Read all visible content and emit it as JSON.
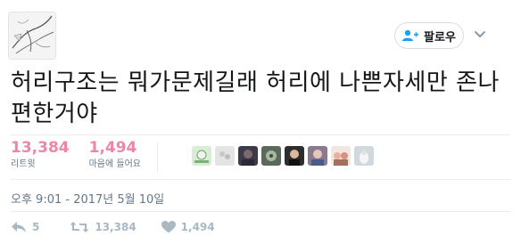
{
  "profile": {
    "avatar_alt": "manga sketch avatar"
  },
  "follow": {
    "label": "팔로우",
    "icon": "add-user-icon"
  },
  "tweet": {
    "text": "허리구조는 뭐가문제길래 허리에 나쁜자세만 존나편한거야"
  },
  "stats": {
    "retweets": {
      "count": "13,384",
      "label": "리트윗"
    },
    "likes": {
      "count": "1,494",
      "label": "마음에 들어요"
    }
  },
  "likers": [
    "liker-1",
    "liker-2",
    "liker-3",
    "liker-4",
    "liker-5",
    "liker-6",
    "liker-7",
    "liker-8",
    "liker-9"
  ],
  "timestamp": "오후 9:01 - 2017년 5월 10일",
  "actions": {
    "reply": {
      "count": "5"
    },
    "retweet": {
      "count": "13,384"
    },
    "like": {
      "count": "1,494"
    }
  },
  "colors": {
    "accent": "#1da1f2",
    "like": "#e0245e",
    "muted": "#657786",
    "icon": "#aab8c2"
  }
}
